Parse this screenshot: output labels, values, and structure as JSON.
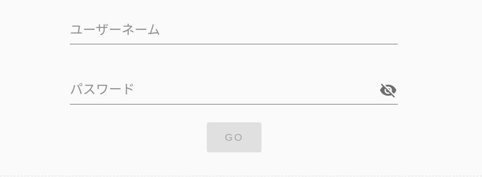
{
  "form": {
    "username": {
      "placeholder": "ユーザーネーム",
      "value": ""
    },
    "password": {
      "placeholder": "パスワード",
      "value": "",
      "visibility_icon": "eye-off-icon"
    },
    "submit_label": "GO"
  },
  "colors": {
    "background": "#fafafa",
    "underline": "#8a8a8a",
    "placeholder": "#8e8e8e",
    "icon": "#6e6e6e",
    "button_bg_disabled": "#e0e0e0",
    "button_text_disabled": "#a6a6a6"
  }
}
